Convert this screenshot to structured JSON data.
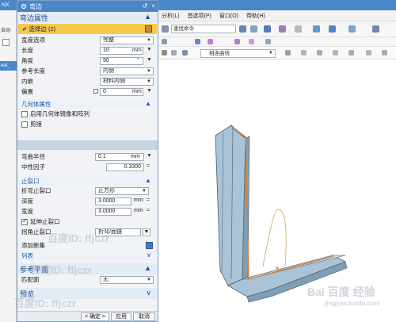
{
  "app": {
    "short_title": "NX"
  },
  "menubar": [
    "分析(L)",
    "首选项(P)",
    "窗口(O)",
    "帮助(H)"
  ],
  "toolbar": {
    "search_value": "查找命令",
    "curve_filter": "相连曲线"
  },
  "left_strip": {
    "label1": "自动·",
    "part_tab": "eet_"
  },
  "dialog": {
    "title": "弯边",
    "section_main": "弯边属性",
    "select_edge": "✔ 选择边 (2)",
    "width_option": {
      "label": "宽度选项",
      "value": "完整"
    },
    "length": {
      "label": "长度",
      "value": "10",
      "unit": "mm"
    },
    "angle": {
      "label": "角度",
      "value": "90",
      "unit": "°"
    },
    "ref_length": {
      "label": "参考长度",
      "value": "内侧"
    },
    "inset": {
      "label": "内嵌",
      "value": "材料内侧"
    },
    "offset": {
      "label": "偏置",
      "value": "0",
      "unit": "mm"
    },
    "geom_section": "几何体属性",
    "enable_mirror": "启用几何体镜像和阵列",
    "trim": "剪接",
    "bend_radius": {
      "label": "弯曲半径",
      "value": "0.1",
      "unit": "mm"
    },
    "neutral_factor": {
      "label": "中性因子",
      "value": "0.3300"
    },
    "relief_section": "止裂口",
    "bend_relief": {
      "label": "折弯止裂口",
      "value": "正方形"
    },
    "depth": {
      "label": "深度",
      "value": "3.0000",
      "unit": "mm"
    },
    "width": {
      "label": "宽度",
      "value": "3.0000",
      "unit": "mm"
    },
    "extend_relief": "延伸止裂口",
    "corner_relief": {
      "label": "拐角止裂口",
      "value": "折弯/面链"
    },
    "add_set": "添加新集",
    "list": "列表",
    "ref_plane_section": "参考平面",
    "match_plane": {
      "label": "匹配面",
      "value": "无"
    },
    "preview_section": "预览",
    "ok": "< 确定 >",
    "apply": "应用",
    "cancel": "取消"
  },
  "watermark": {
    "text": "百度ID: ffjczr",
    "logo": "Bai 百度 经验",
    "url": "jingyan.baidu.com"
  },
  "colors": {
    "accent": "#4a87c9",
    "dialog_bg": "#f1f3f6",
    "model_blue": "#a9c4d8",
    "model_edge": "#e07b2a"
  }
}
